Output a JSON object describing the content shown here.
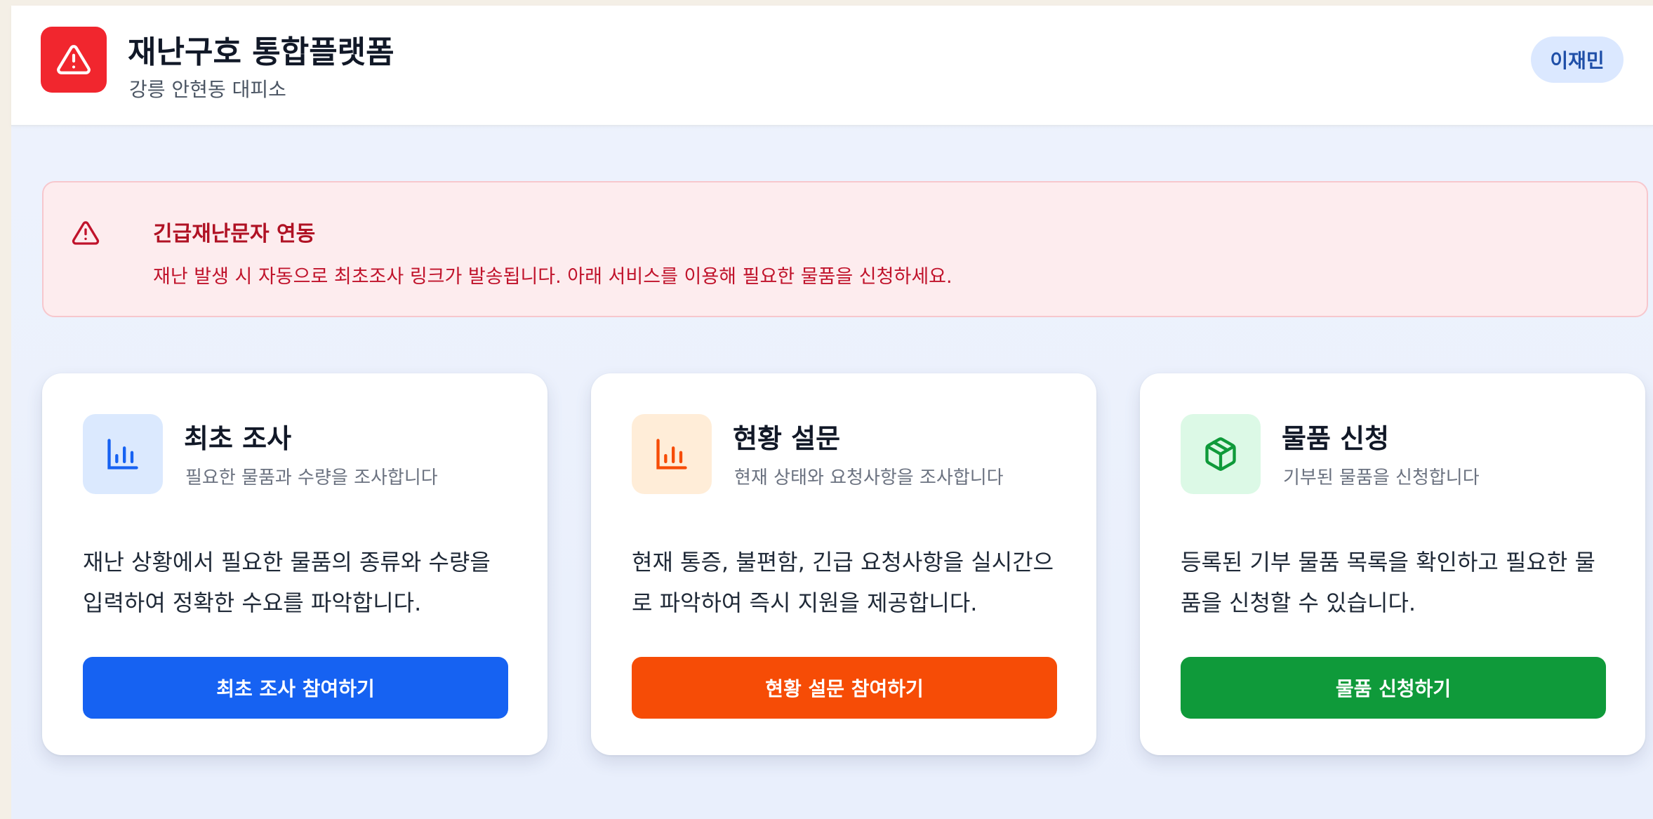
{
  "header": {
    "title": "재난구호 통합플랫폼",
    "subtitle": "강릉 안현동 대피소",
    "user": "이재민",
    "logo_icon": "warning-triangle-icon",
    "logo_color": "#f1262e"
  },
  "alert": {
    "icon": "warning-triangle-icon",
    "title": "긴급재난문자 연동",
    "message": "재난 발생 시 자동으로 최초조사 링크가 발송됩니다. 아래 서비스를 이용해 필요한 물품을 신청하세요."
  },
  "cards": [
    {
      "icon": "bar-chart-icon",
      "accent": "#1662f2",
      "title": "최초 조사",
      "subtitle": "필요한 물품과 수량을 조사합니다",
      "description": "재난 상황에서 필요한 물품의 종류와 수량을 입력하여 정확한 수요를 파악합니다.",
      "button": "최초 조사 참여하기"
    },
    {
      "icon": "bar-chart-icon",
      "accent": "#f64c06",
      "title": "현황 설문",
      "subtitle": "현재 상태와 요청사항을 조사합니다",
      "description": "현재 통증, 불편함, 긴급 요청사항을 실시간으로 파악하여 즉시 지원을 제공합니다.",
      "button": "현황 설문 참여하기"
    },
    {
      "icon": "package-box-icon",
      "accent": "#0f9a3a",
      "title": "물품 신청",
      "subtitle": "기부된 물품을 신청합니다",
      "description": "등록된 기부 물품 목록을 확인하고 필요한 물품을 신청할 수 있습니다.",
      "button": "물품 신청하기"
    }
  ]
}
